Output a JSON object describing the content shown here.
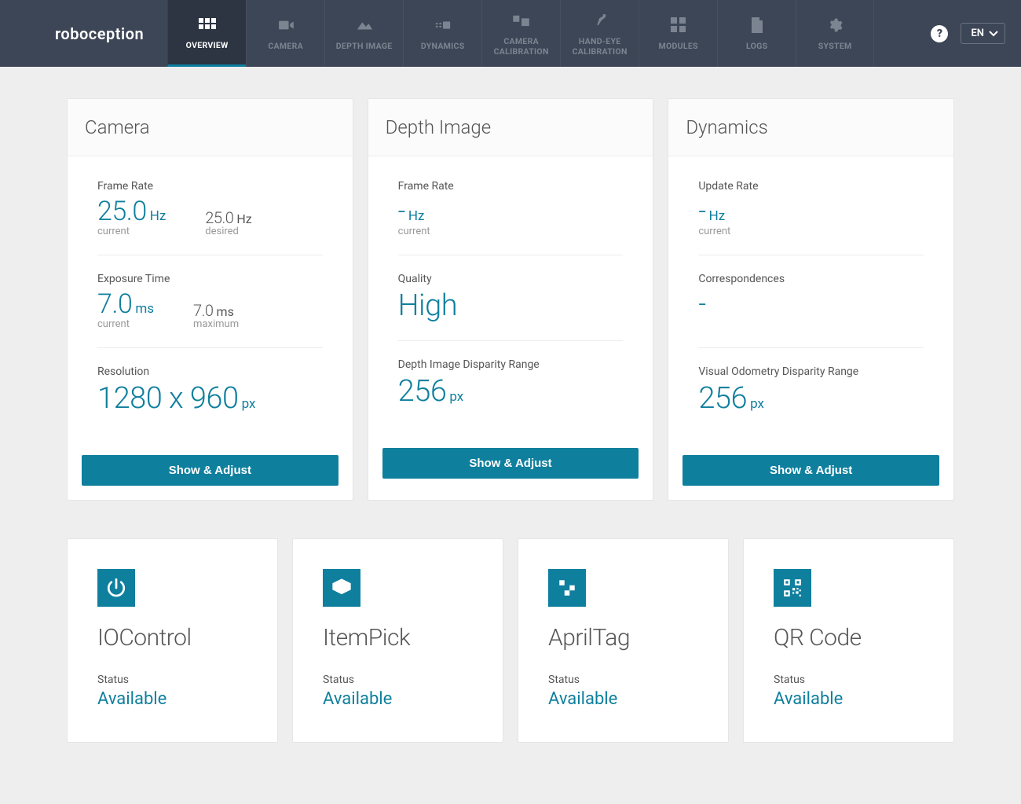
{
  "brand": "roboception",
  "nav": {
    "tabs": [
      {
        "id": "overview",
        "label": "OVERVIEW"
      },
      {
        "id": "camera",
        "label": "CAMERA"
      },
      {
        "id": "depth",
        "label": "DEPTH IMAGE"
      },
      {
        "id": "dynamics",
        "label": "DYNAMICS"
      },
      {
        "id": "camcal",
        "label": "CAMERA CALIBRATION"
      },
      {
        "id": "handeye",
        "label": "HAND-EYE CALIBRATION"
      },
      {
        "id": "modules",
        "label": "MODULES"
      },
      {
        "id": "logs",
        "label": "LOGS"
      },
      {
        "id": "system",
        "label": "SYSTEM"
      }
    ],
    "lang": "EN"
  },
  "cards": {
    "camera": {
      "title": "Camera",
      "frame_rate": {
        "label": "Frame Rate",
        "current_value": "25.0",
        "current_unit": "Hz",
        "current_sub": "current",
        "desired_value": "25.0",
        "desired_unit": "Hz",
        "desired_sub": "desired"
      },
      "exposure": {
        "label": "Exposure Time",
        "current_value": "7.0",
        "current_unit": "ms",
        "current_sub": "current",
        "max_value": "7.0",
        "max_unit": "ms",
        "max_sub": "maximum"
      },
      "resolution": {
        "label": "Resolution",
        "value": "1280 x 960",
        "unit": "px"
      },
      "button": "Show & Adjust"
    },
    "depth": {
      "title": "Depth Image",
      "frame_rate": {
        "label": "Frame Rate",
        "value": "-",
        "unit": "Hz",
        "sub": "current"
      },
      "quality": {
        "label": "Quality",
        "value": "High"
      },
      "disparity": {
        "label": "Depth Image Disparity Range",
        "value": "256",
        "unit": "px"
      },
      "button": "Show & Adjust"
    },
    "dynamics": {
      "title": "Dynamics",
      "update_rate": {
        "label": "Update Rate",
        "value": "-",
        "unit": "Hz",
        "sub": "current"
      },
      "correspondences": {
        "label": "Correspondences",
        "value": "-"
      },
      "disparity": {
        "label": "Visual Odometry Disparity Range",
        "value": "256",
        "unit": "px"
      },
      "button": "Show & Adjust"
    }
  },
  "modules": {
    "iocontrol": {
      "title": "IOControl",
      "status_label": "Status",
      "status_value": "Available"
    },
    "itempick": {
      "title": "ItemPick",
      "status_label": "Status",
      "status_value": "Available"
    },
    "apriltag": {
      "title": "AprilTag",
      "status_label": "Status",
      "status_value": "Available"
    },
    "qrcode": {
      "title": "QR Code",
      "status_label": "Status",
      "status_value": "Available"
    }
  }
}
